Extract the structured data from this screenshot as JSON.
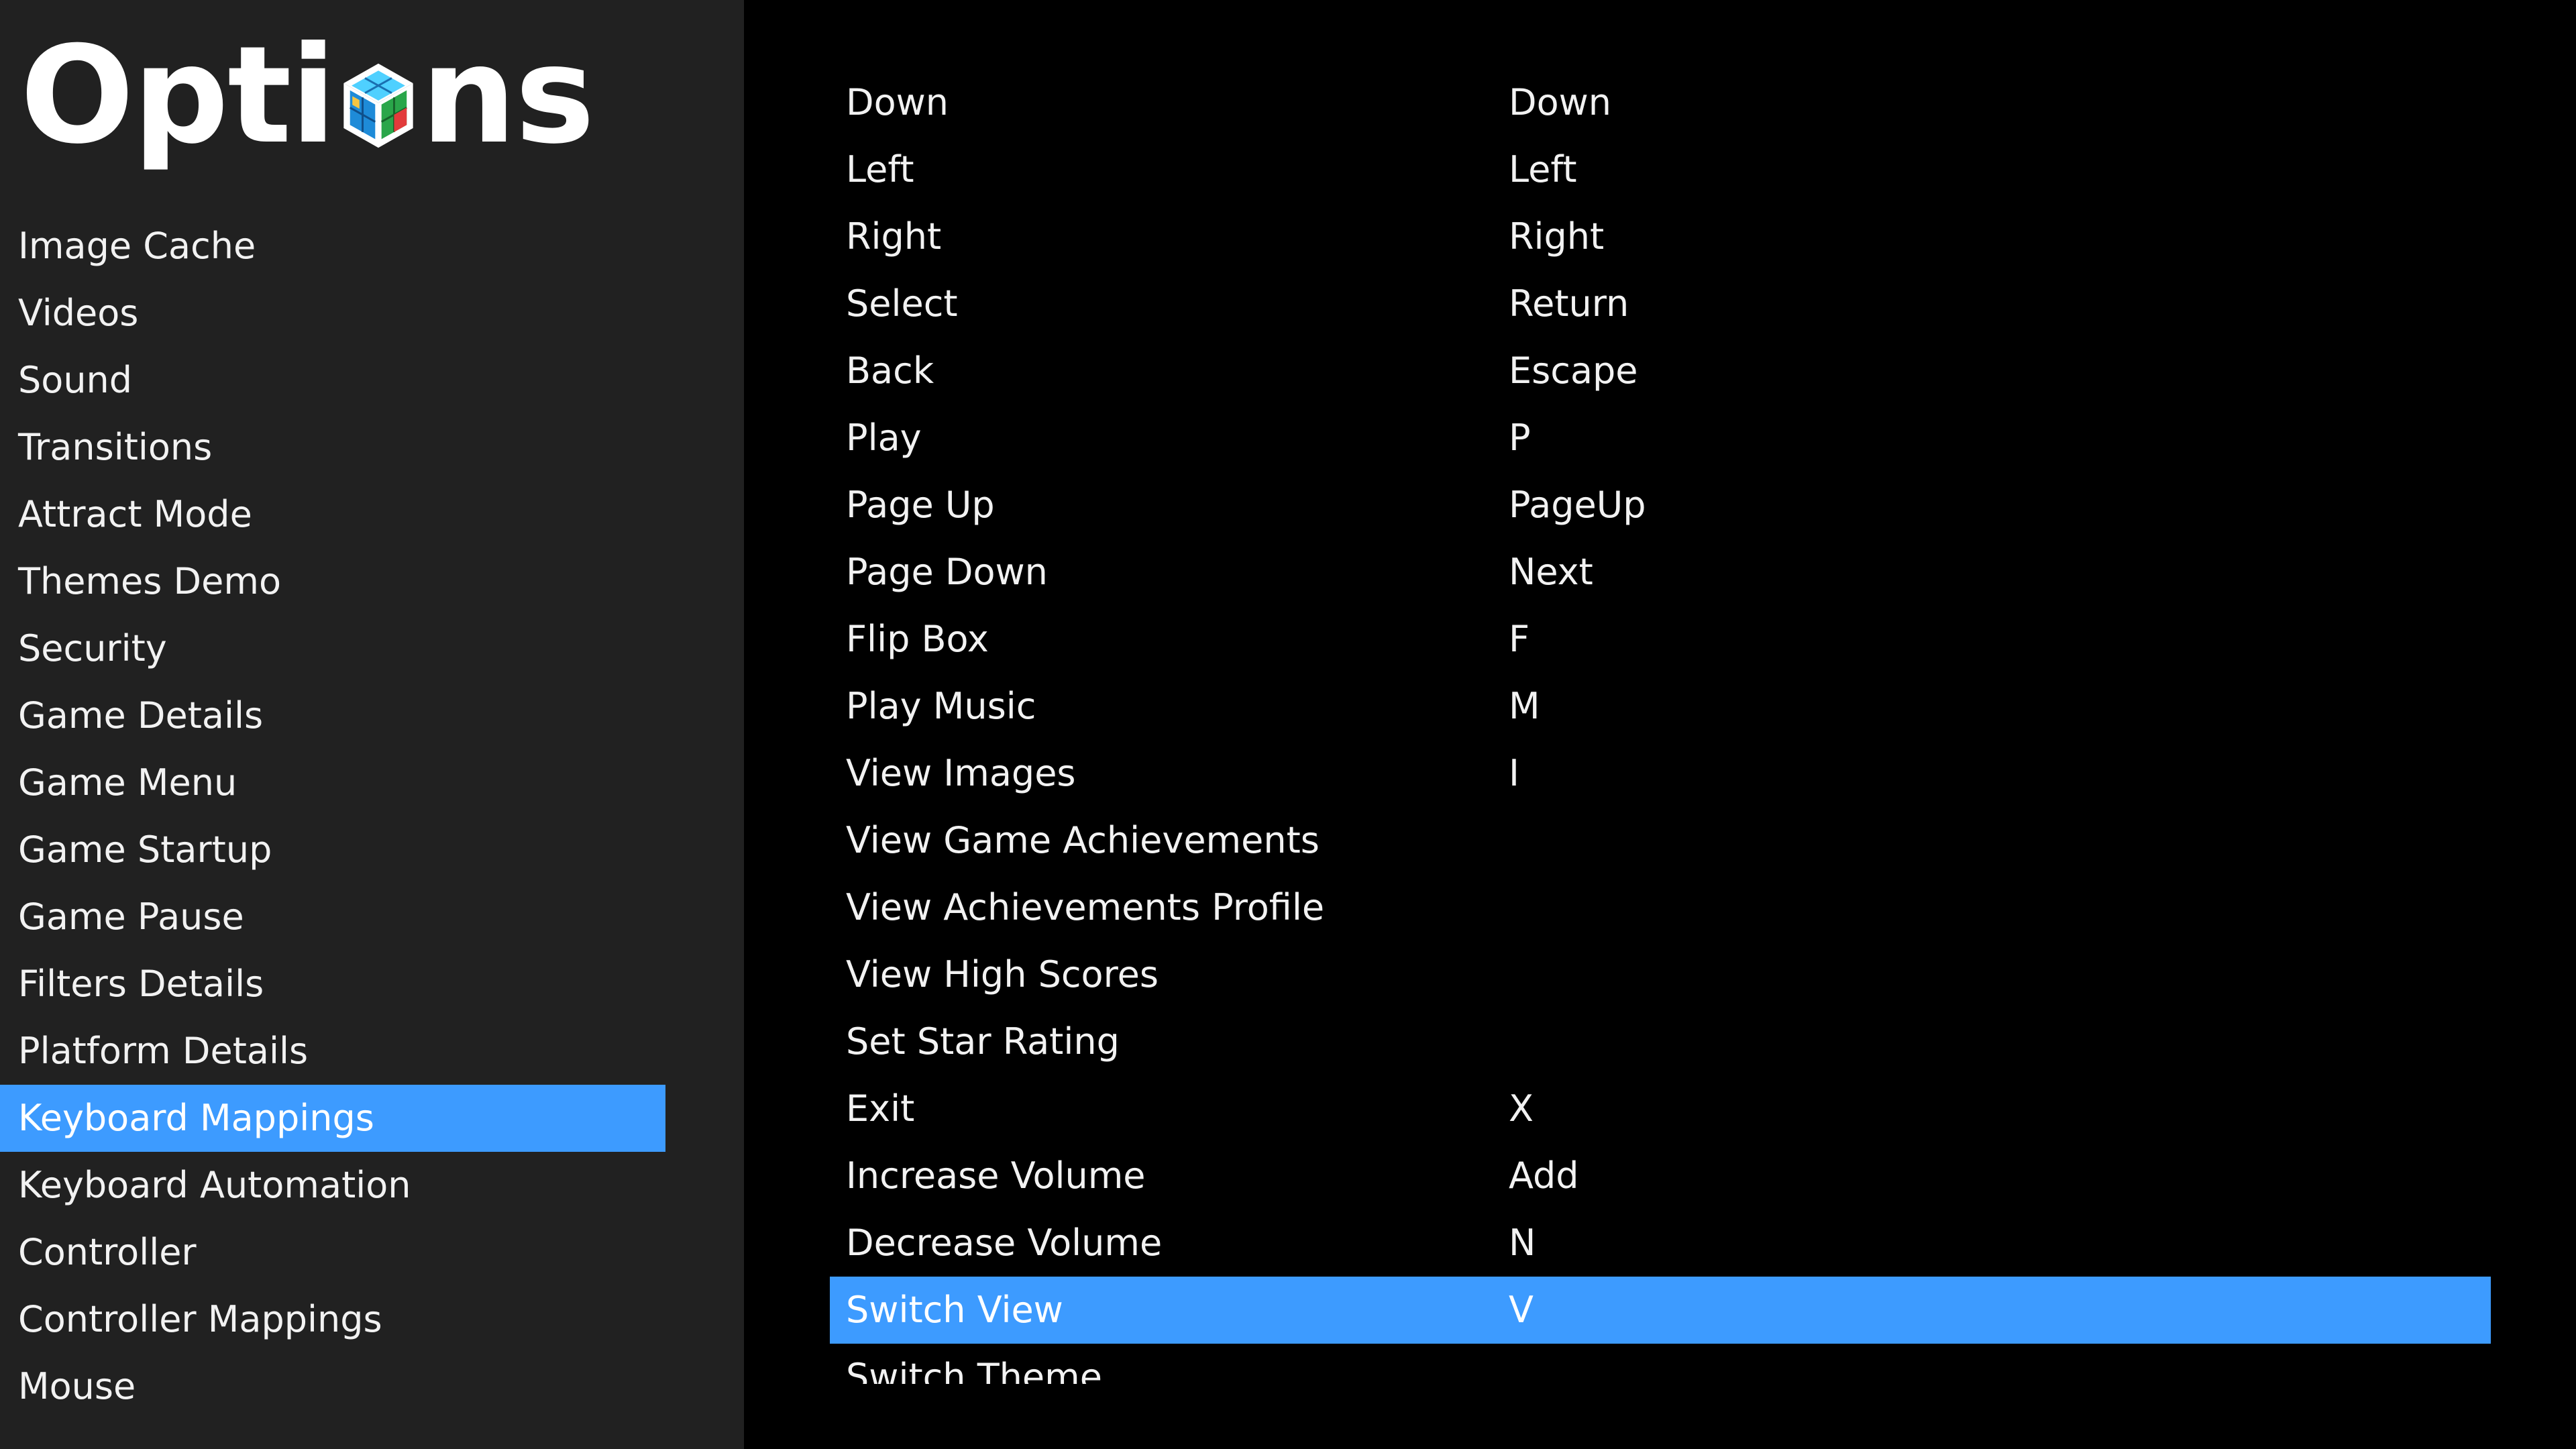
{
  "sidebar": {
    "title_prefix": "Opti",
    "title_suffix": "ns",
    "logo_icon": "cube-logo-icon",
    "items": [
      {
        "label": "Image Cache"
      },
      {
        "label": "Videos"
      },
      {
        "label": "Sound"
      },
      {
        "label": "Transitions"
      },
      {
        "label": "Attract Mode"
      },
      {
        "label": "Themes Demo"
      },
      {
        "label": "Security"
      },
      {
        "label": "Game Details"
      },
      {
        "label": "Game Menu"
      },
      {
        "label": "Game Startup"
      },
      {
        "label": "Game Pause"
      },
      {
        "label": "Filters Details"
      },
      {
        "label": "Platform Details"
      },
      {
        "label": "Keyboard Mappings",
        "selected": true
      },
      {
        "label": "Keyboard Automation"
      },
      {
        "label": "Controller"
      },
      {
        "label": "Controller Mappings"
      },
      {
        "label": "Mouse"
      }
    ]
  },
  "mappings": [
    {
      "action": "Down",
      "key": "Down"
    },
    {
      "action": "Left",
      "key": "Left"
    },
    {
      "action": "Right",
      "key": "Right"
    },
    {
      "action": "Select",
      "key": "Return"
    },
    {
      "action": "Back",
      "key": "Escape"
    },
    {
      "action": "Play",
      "key": "P"
    },
    {
      "action": "Page Up",
      "key": "PageUp"
    },
    {
      "action": "Page Down",
      "key": "Next"
    },
    {
      "action": "Flip Box",
      "key": "F"
    },
    {
      "action": "Play Music",
      "key": "M"
    },
    {
      "action": "View Images",
      "key": "I"
    },
    {
      "action": "View Game Achievements",
      "key": ""
    },
    {
      "action": "View Achievements Profile",
      "key": ""
    },
    {
      "action": "View High Scores",
      "key": ""
    },
    {
      "action": "Set Star Rating",
      "key": ""
    },
    {
      "action": "Exit",
      "key": "X"
    },
    {
      "action": "Increase Volume",
      "key": "Add"
    },
    {
      "action": "Decrease Volume",
      "key": "N"
    },
    {
      "action": "Switch View",
      "key": "V",
      "selected": true
    },
    {
      "action": "Switch Theme",
      "key": ""
    }
  ],
  "colors": {
    "accent": "#3d9bff",
    "sidebar_bg": "#212121",
    "content_bg": "#000000",
    "text": "#f2f2f2"
  }
}
